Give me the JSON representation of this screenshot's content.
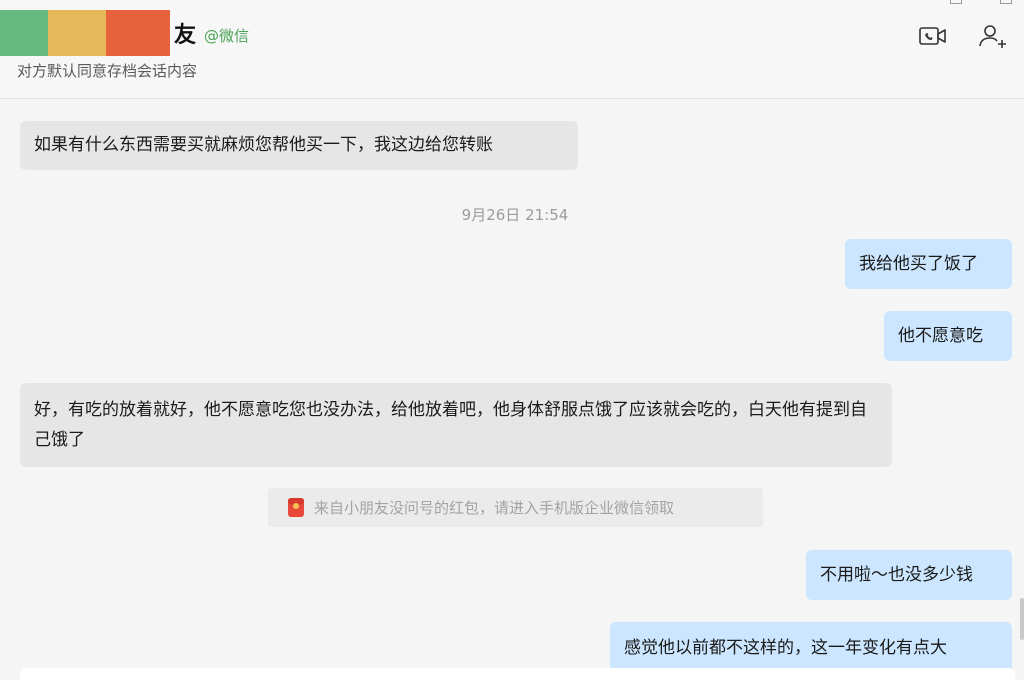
{
  "header": {
    "contact_name_suffix": "友",
    "source_tag": "@微信",
    "subtitle": "对方默认同意存档会话内容",
    "icons": [
      "video-call-icon",
      "add-member-icon"
    ]
  },
  "messages": [
    {
      "side": "left",
      "text": "如果有什么东西需要买就麻烦您帮他买一下，我这边给您转账"
    },
    {
      "side": "right",
      "text": "我给他买了饭了"
    },
    {
      "side": "right",
      "text": "他不愿意吃"
    },
    {
      "side": "left",
      "text": "好，有吃的放着就好，他不愿意吃您也没办法，给他放着吧，他身体舒服点饿了应该就会吃的，白天他有提到自己饿了"
    },
    {
      "side": "right",
      "text": "不用啦～也没多少钱"
    },
    {
      "side": "right",
      "text": "感觉他以前都不这样的，这一年变化有点大"
    }
  ],
  "timestamp": "9月26日 21:54",
  "red_packet": {
    "text": "来自小朋友没问号的红包，请进入手机版企业微信领取",
    "icon": "red-packet-icon"
  },
  "colors": {
    "bubble_left": "#e6e6e6",
    "bubble_right": "#cce6ff",
    "source_tag": "#4aa355",
    "background": "#f5f5f5"
  }
}
